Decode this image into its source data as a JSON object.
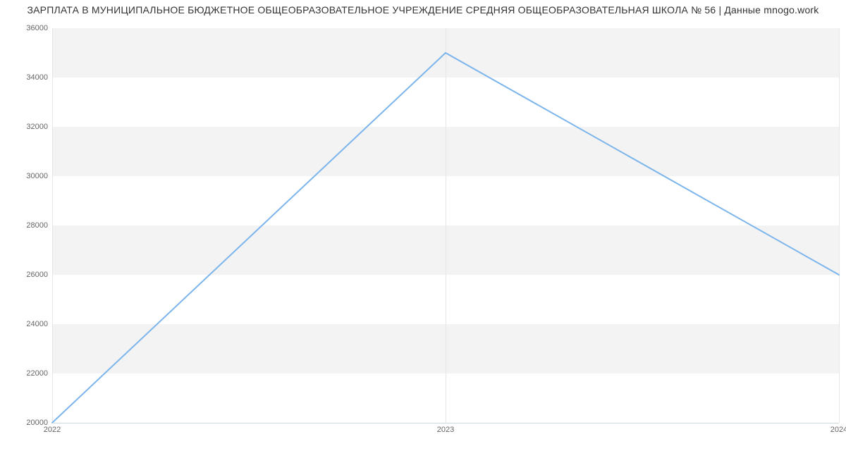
{
  "chart_data": {
    "type": "line",
    "title": "ЗАРПЛАТА В МУНИЦИПАЛЬНОЕ БЮДЖЕТНОЕ ОБЩЕОБРАЗОВАТЕЛЬНОЕ УЧРЕЖДЕНИЕ СРЕДНЯЯ ОБЩЕОБРАЗОВАТЕЛЬНАЯ ШКОЛА № 56 | Данные mnogo.work",
    "xlabel": "",
    "ylabel": "",
    "x": [
      "2022",
      "2023",
      "2024"
    ],
    "values": [
      20000,
      35000,
      26000
    ],
    "y_ticks": [
      20000,
      22000,
      24000,
      26000,
      28000,
      30000,
      32000,
      34000,
      36000
    ],
    "ylim": [
      20000,
      36000
    ],
    "colors": {
      "line": "#7cb5ec",
      "band": "#f3f3f3"
    }
  }
}
